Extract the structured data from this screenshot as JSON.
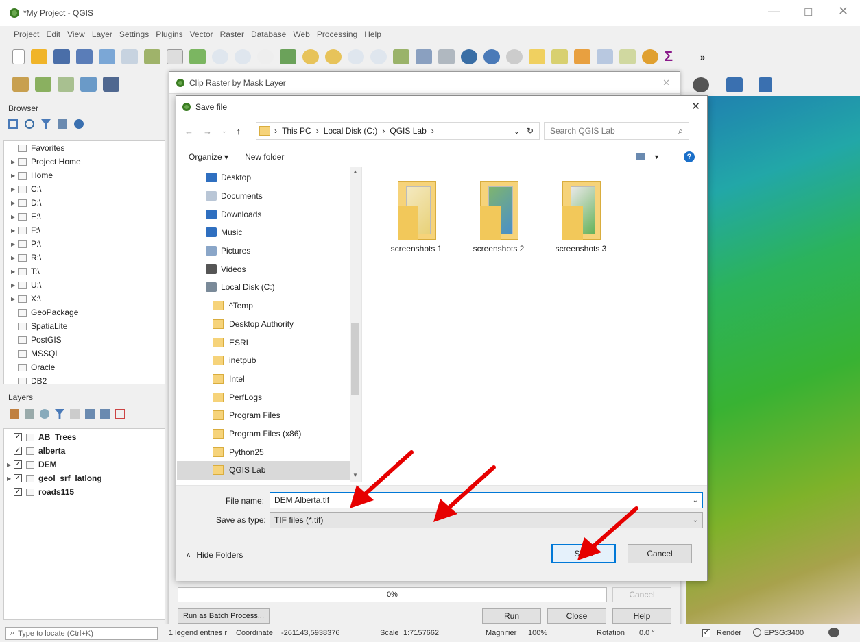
{
  "window": {
    "title": "*My Project - QGIS"
  },
  "menu": [
    "Project",
    "Edit",
    "View",
    "Layer",
    "Settings",
    "Plugins",
    "Vector",
    "Raster",
    "Database",
    "Web",
    "Processing",
    "Help"
  ],
  "toolbar": {
    "more": "»"
  },
  "browser": {
    "title": "Browser",
    "items": [
      {
        "label": "Favorites",
        "arrow": false,
        "icon": "star-icon"
      },
      {
        "label": "Project Home",
        "arrow": true,
        "icon": "project-home-icon"
      },
      {
        "label": "Home",
        "arrow": true,
        "icon": "home-icon"
      },
      {
        "label": "C:\\",
        "arrow": true,
        "icon": "drive-icon"
      },
      {
        "label": "D:\\",
        "arrow": true,
        "icon": "drive-icon"
      },
      {
        "label": "E:\\",
        "arrow": true,
        "icon": "drive-icon"
      },
      {
        "label": "F:\\",
        "arrow": true,
        "icon": "drive-icon"
      },
      {
        "label": "P:\\",
        "arrow": true,
        "icon": "drive-icon"
      },
      {
        "label": "R:\\",
        "arrow": true,
        "icon": "drive-icon"
      },
      {
        "label": "T:\\",
        "arrow": true,
        "icon": "drive-icon"
      },
      {
        "label": "U:\\",
        "arrow": true,
        "icon": "drive-icon"
      },
      {
        "label": "X:\\",
        "arrow": true,
        "icon": "drive-icon"
      },
      {
        "label": "GeoPackage",
        "arrow": false,
        "icon": "geopackage-icon"
      },
      {
        "label": "SpatiaLite",
        "arrow": false,
        "icon": "spatialite-icon"
      },
      {
        "label": "PostGIS",
        "arrow": false,
        "icon": "postgis-icon"
      },
      {
        "label": "MSSQL",
        "arrow": false,
        "icon": "mssql-icon"
      },
      {
        "label": "Oracle",
        "arrow": false,
        "icon": "oracle-icon"
      },
      {
        "label": "DB2",
        "arrow": false,
        "icon": "db2-icon"
      }
    ]
  },
  "layers": {
    "title": "Layers",
    "items": [
      {
        "label": "AB_Trees",
        "checked": true,
        "arrow": false,
        "underline": true,
        "icon": "point-layer-icon"
      },
      {
        "label": "alberta",
        "checked": true,
        "arrow": false,
        "underline": false,
        "icon": "polygon-layer-icon"
      },
      {
        "label": "DEM",
        "checked": true,
        "arrow": true,
        "underline": false,
        "icon": "raster-layer-icon"
      },
      {
        "label": "geol_srf_latlong",
        "checked": true,
        "arrow": true,
        "underline": false,
        "icon": "polygon-layer-icon"
      },
      {
        "label": "roads115",
        "checked": true,
        "arrow": false,
        "underline": false,
        "icon": "line-layer-icon"
      }
    ]
  },
  "clip_dialog": {
    "title": "Clip Raster by Mask Layer",
    "progress": "0%",
    "progress_value": 0,
    "cancel": "Cancel",
    "batch": "Run as Batch Process...",
    "run": "Run",
    "close": "Close",
    "help": "Help"
  },
  "save_dialog": {
    "title": "Save file",
    "breadcrumb": [
      "This PC",
      "Local Disk (C:)",
      "QGIS Lab"
    ],
    "search_placeholder": "Search QGIS Lab",
    "organize": "Organize ▾",
    "new_folder": "New folder",
    "nav": [
      {
        "label": "Desktop",
        "type": "special",
        "color": "#2f6fc0",
        "indent": 0
      },
      {
        "label": "Documents",
        "type": "special",
        "color": "#b9c6d6",
        "indent": 0
      },
      {
        "label": "Downloads",
        "type": "special",
        "color": "#2f6fc0",
        "indent": 0
      },
      {
        "label": "Music",
        "type": "special",
        "color": "#2f6fc0",
        "indent": 0
      },
      {
        "label": "Pictures",
        "type": "special",
        "color": "#8aa6c8",
        "indent": 0
      },
      {
        "label": "Videos",
        "type": "special",
        "color": "#555",
        "indent": 0
      },
      {
        "label": "Local Disk (C:)",
        "type": "special",
        "color": "#7a8a99",
        "indent": 0
      },
      {
        "label": "^Temp",
        "type": "folder",
        "indent": 1
      },
      {
        "label": "Desktop Authority",
        "type": "folder",
        "indent": 1
      },
      {
        "label": "ESRI",
        "type": "folder",
        "indent": 1
      },
      {
        "label": "inetpub",
        "type": "folder",
        "indent": 1
      },
      {
        "label": "Intel",
        "type": "folder",
        "indent": 1
      },
      {
        "label": "PerfLogs",
        "type": "folder",
        "indent": 1
      },
      {
        "label": "Program Files",
        "type": "folder",
        "indent": 1
      },
      {
        "label": "Program Files (x86)",
        "type": "folder",
        "indent": 1
      },
      {
        "label": "Python25",
        "type": "folder",
        "indent": 1
      },
      {
        "label": "QGIS Lab",
        "type": "folder",
        "indent": 1,
        "selected": true
      }
    ],
    "folders": [
      "screenshots 1",
      "screenshots 2",
      "screenshots 3"
    ],
    "file_name_label": "File name:",
    "file_name_value": "DEM Alberta.tif",
    "save_type_label": "Save as type:",
    "save_type_value": "TIF files (*.tif)",
    "hide_folders": "Hide Folders",
    "save": "Save",
    "cancel": "Cancel"
  },
  "statusbar": {
    "locate_placeholder": "Type to locate (Ctrl+K)",
    "legend": "1 legend entries r",
    "coordinate_label": "Coordinate",
    "coordinate_value": "-261143,5938376",
    "scale_label": "Scale",
    "scale_value": "1:7157662",
    "magnifier_label": "Magnifier",
    "magnifier_value": "100%",
    "rotation_label": "Rotation",
    "rotation_value": "0.0 °",
    "render": "Render",
    "crs": "EPSG:3400"
  },
  "colors": {
    "accent": "#0078d7",
    "arrow": "#e60000",
    "selection": "#cce8ff"
  }
}
